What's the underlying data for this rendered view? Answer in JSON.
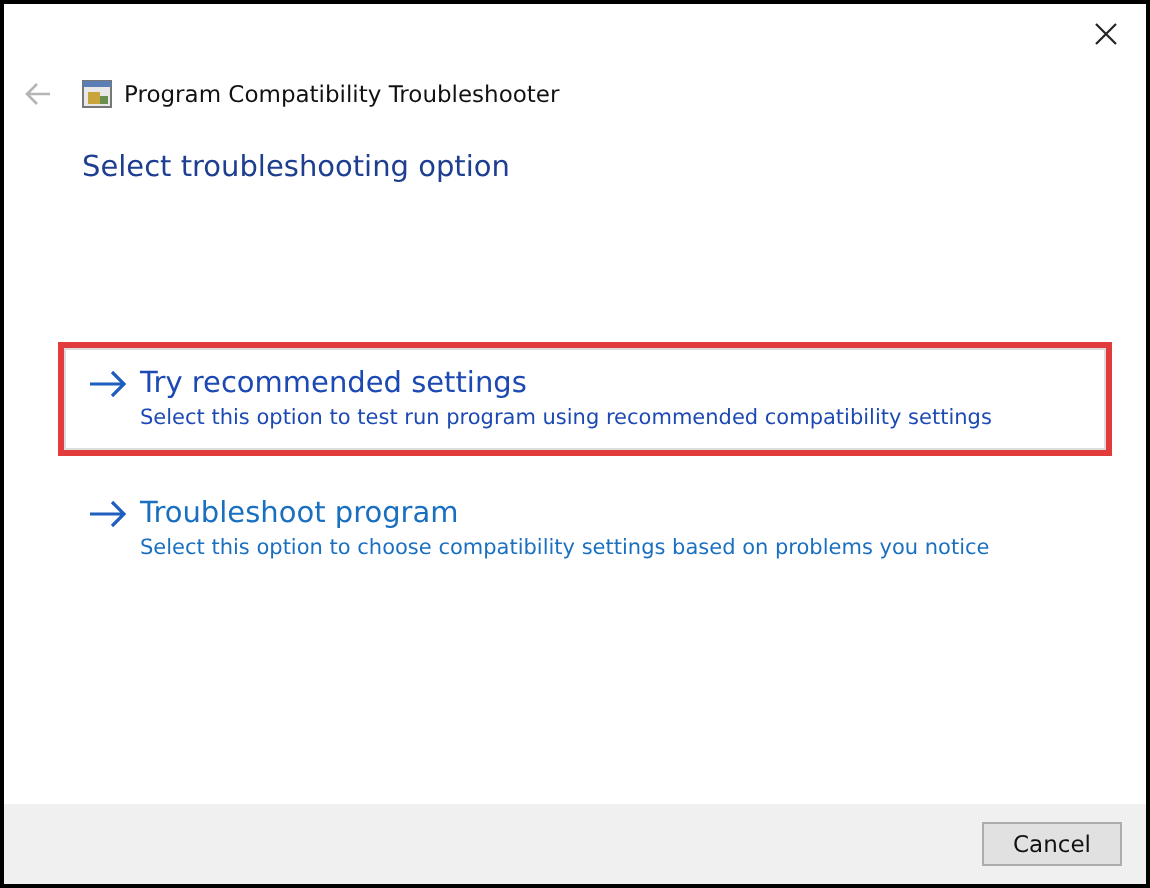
{
  "window": {
    "title": "Program Compatibility Troubleshooter"
  },
  "heading": "Select troubleshooting option",
  "options": [
    {
      "title": "Try recommended settings",
      "description": "Select this option to test run program using recommended compatibility settings",
      "selected": true
    },
    {
      "title": "Troubleshoot program",
      "description": "Select this option to choose compatibility settings based on problems you notice",
      "selected": false
    }
  ],
  "buttons": [
    "Cancel"
  ]
}
